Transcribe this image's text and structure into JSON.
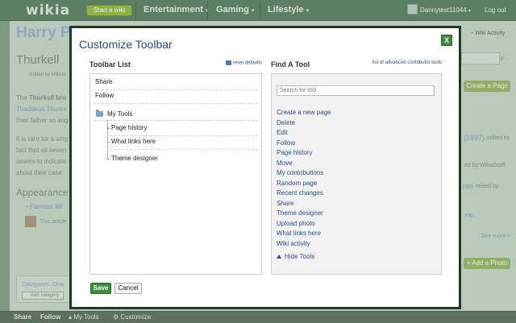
{
  "topbar": {
    "logo": "wikia",
    "start_wiki": "Start a wiki",
    "nav": [
      "Entertainment",
      "Gaming",
      "Lifestyle"
    ],
    "username": "Dannytest11044",
    "logout": "Log out"
  },
  "page": {
    "wiki_title": "Harry P",
    "wiki_activity": "Wiki Activity",
    "article_title": "Thurkell",
    "edited_by": "Edited by MBroo",
    "text1_a": "The ",
    "text1_b": "Thurkell bro",
    "text2": "Thaddeus Thurke",
    "text3": "their father so ang",
    "text4": "It is rare for a sing",
    "text5": "fact that all seven",
    "text6": "seems to indicate",
    "text7": "about their case.",
    "appearances": "Appearance",
    "bullet_link": "Famous Wi",
    "this_article": "This article",
    "categories": "Categories: Char",
    "add_category": "Add category"
  },
  "rail": {
    "create_page": "Create a Page",
    "year": "(1997)",
    "edited_by": "edited by",
    "by_staff": "ed by WikiaStaff",
    "ren": "ren",
    "edited_by2": "edited by",
    "ysp": "ysp",
    "see_more": "See more >",
    "add_photo": "Add a Photo"
  },
  "bottombar": {
    "items": [
      "Share",
      "Follow",
      "My Tools",
      "Customize"
    ]
  },
  "modal": {
    "title": "Customize Toolbar",
    "close": "X",
    "toolbar_list": {
      "title": "Toolbar List",
      "reset": "reset defaults",
      "items": [
        "Share",
        "Follow"
      ],
      "folder": "My Tools",
      "children": [
        "Page history",
        "What links here",
        "Theme designer"
      ]
    },
    "find_tool": {
      "title": "Find A Tool",
      "advanced": "list of advanced contributor tools",
      "placeholder": "Search for tool",
      "tools": [
        "Create a new page",
        "Delete",
        "Edit",
        "Follow",
        "Page history",
        "Move",
        "My contributions",
        "Random page",
        "Recent changes",
        "Share",
        "Theme designer",
        "Upload photo",
        "What links here",
        "Wiki activity"
      ],
      "hide": "Hide Tools"
    },
    "save": "Save",
    "cancel": "Cancel"
  }
}
